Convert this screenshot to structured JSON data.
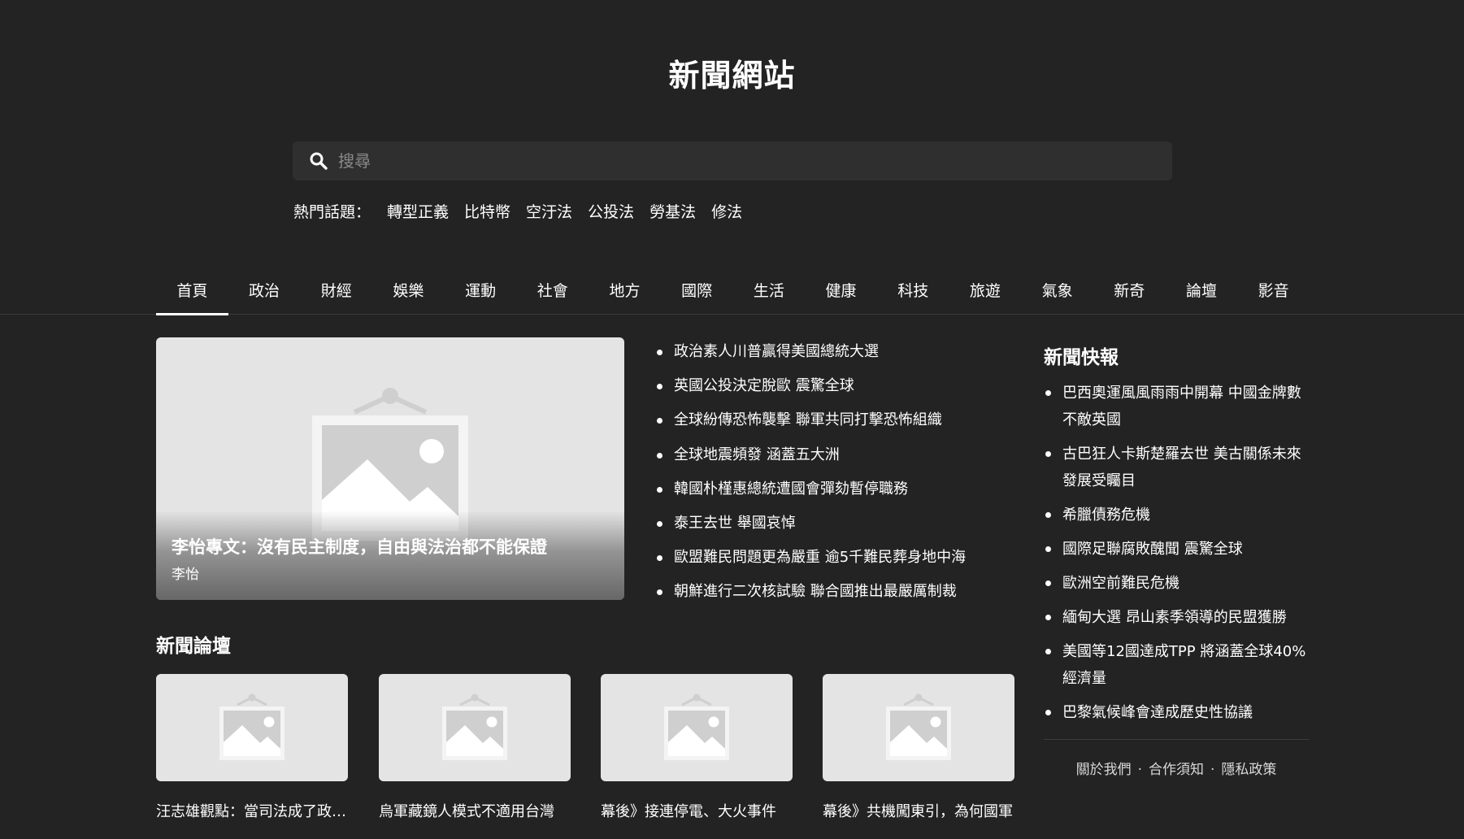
{
  "site": {
    "title": "新聞網站"
  },
  "search": {
    "placeholder": "搜尋"
  },
  "hot_topics": {
    "label": "熱門話題：",
    "items": [
      "轉型正義",
      "比特幣",
      "空汙法",
      "公投法",
      "勞基法",
      "修法"
    ]
  },
  "nav": {
    "tabs": [
      "首頁",
      "政治",
      "財經",
      "娛樂",
      "運動",
      "社會",
      "地方",
      "國際",
      "生活",
      "健康",
      "科技",
      "旅遊",
      "氣象",
      "新奇",
      "論壇",
      "影音"
    ],
    "active": "首頁"
  },
  "featured": {
    "title": "李怡專文：沒有民主制度，自由與法治都不能保證",
    "author": "李怡"
  },
  "headlines": [
    "政治素人川普贏得美國總統大選",
    "英國公投決定脫歐 震驚全球",
    "全球紛傳恐怖襲擊 聯軍共同打擊恐怖組織",
    "全球地震頻發 涵蓋五大洲",
    "韓國朴槿惠總統遭國會彈劾暫停職務",
    "泰王去世 舉國哀悼",
    "歐盟難民問題更為嚴重 逾5千難民葬身地中海",
    "朝鮮進行二次核試驗 聯合國推出最嚴厲制裁"
  ],
  "forum": {
    "title": "新聞論壇",
    "cards": [
      "汪志雄觀點：當司法成了政治工具",
      "烏軍藏鏡人模式不適用台灣",
      "幕後》接連停電、大火事件",
      "幕後》共機闖東引，為何國軍"
    ]
  },
  "flash_news": {
    "title": "新聞快報",
    "items": [
      "巴西奧運風風雨雨中開幕 中國金牌數不敵英國",
      "古巴狂人卡斯楚羅去世 美古關係未來發展受矚目",
      "希臘債務危機",
      "國際足聯腐敗醜聞 震驚全球",
      "歐洲空前難民危機",
      "緬甸大選 昂山素季領導的民盟獲勝",
      "美國等12國達成TPP 將涵蓋全球40%經濟量",
      "巴黎氣候峰會達成歷史性協議"
    ]
  },
  "footer": {
    "links": [
      "關於我們",
      "合作須知",
      "隱私政策"
    ],
    "separator": "·"
  }
}
